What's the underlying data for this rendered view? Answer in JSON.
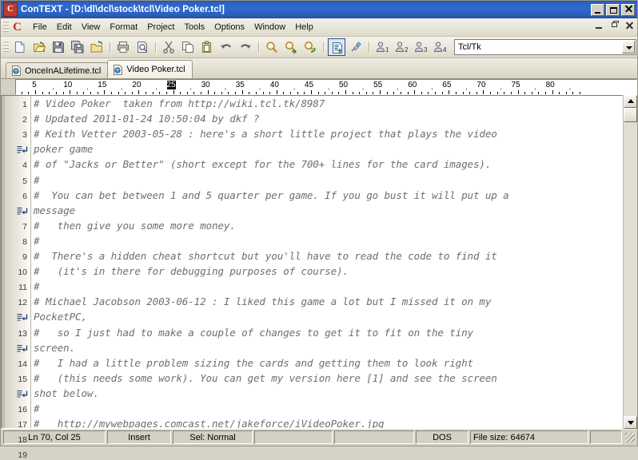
{
  "window": {
    "title": "ConTEXT - [D:\\dl\\dcl\\stock\\tcl\\Video Poker.tcl]",
    "app_icon": "C",
    "buttons": {
      "minimize": "minimize-icon",
      "maximize": "maximize-icon",
      "close": "close-icon"
    }
  },
  "menu": {
    "logo": "C",
    "items": [
      "File",
      "Edit",
      "View",
      "Format",
      "Project",
      "Tools",
      "Options",
      "Window",
      "Help"
    ],
    "mdi_buttons": [
      "mdi-minimize-icon",
      "mdi-restore-icon",
      "mdi-close-icon"
    ]
  },
  "toolbar": {
    "icons": [
      "new-file-icon",
      "open-file-icon",
      "save-icon",
      "save-all-icon",
      "open-project-icon",
      "print-icon",
      "print-preview-icon",
      "cut-icon",
      "copy-icon",
      "paste-icon",
      "undo-icon",
      "redo-icon",
      "find-icon",
      "find-next-icon",
      "replace-icon",
      "compile-icon",
      "bookmark-icon",
      "user-exec-1-icon",
      "user-exec-2-icon",
      "user-exec-3-icon",
      "user-exec-4-icon"
    ],
    "highlighter_label": "Tcl/Tk",
    "highlighter_options": [
      "Tcl/Tk"
    ]
  },
  "tabs": [
    {
      "label": "OnceInALifetime.tcl",
      "icon": "tcl-file-icon",
      "active": false
    },
    {
      "label": "Video Poker.tcl",
      "icon": "tcl-file-icon",
      "active": true
    }
  ],
  "ruler": {
    "numbers": [
      5,
      10,
      15,
      20,
      25,
      30,
      35,
      40,
      45,
      50,
      55,
      60,
      65,
      70,
      75,
      80
    ],
    "cursor_column": 25,
    "char_width": 8.62,
    "origin": 5
  },
  "editor": {
    "lines": [
      {
        "num": "1",
        "text": "# Video Poker  taken from http://wiki.tcl.tk/8987",
        "wrap": false
      },
      {
        "num": "2",
        "text": "# Updated 2011-01-24 10:50:04 by dkf ?",
        "wrap": false
      },
      {
        "num": "3",
        "text": "# Keith Vetter 2003-05-28 : here's a short little project that plays the video",
        "wrap": false
      },
      {
        "num": "",
        "text": "poker game",
        "wrap": true
      },
      {
        "num": "4",
        "text": "# of \"Jacks or Better\" (short except for the 700+ lines for the card images).",
        "wrap": false
      },
      {
        "num": "5",
        "text": "#",
        "wrap": false
      },
      {
        "num": "6",
        "text": "#  You can bet between 1 and 5 quarter per game. If you go bust it will put up a",
        "wrap": false
      },
      {
        "num": "",
        "text": "message",
        "wrap": true
      },
      {
        "num": "7",
        "text": "#   then give you some more money.",
        "wrap": false
      },
      {
        "num": "8",
        "text": "#",
        "wrap": false
      },
      {
        "num": "9",
        "text": "#  There's a hidden cheat shortcut but you'll have to read the code to find it",
        "wrap": false
      },
      {
        "num": "10",
        "text": "#   (it's in there for debugging purposes of course).",
        "wrap": false
      },
      {
        "num": "11",
        "text": "#",
        "wrap": false
      },
      {
        "num": "12",
        "text": "# Michael Jacobson 2003-06-12 : I liked this game a lot but I missed it on my",
        "wrap": false
      },
      {
        "num": "",
        "text": "PocketPC,",
        "wrap": true
      },
      {
        "num": "13",
        "text": "#   so I just had to make a couple of changes to get it to fit on the tiny",
        "wrap": false
      },
      {
        "num": "",
        "text": "screen.",
        "wrap": true
      },
      {
        "num": "14",
        "text": "#   I had a little problem sizing the cards and getting them to look right",
        "wrap": false
      },
      {
        "num": "15",
        "text": "#   (this needs some work). You can get my version here [1] and see the screen",
        "wrap": false
      },
      {
        "num": "",
        "text": "shot below.",
        "wrap": true
      },
      {
        "num": "16",
        "text": "#",
        "wrap": false
      },
      {
        "num": "17",
        "text": "#   http://mywebpages.comcast.net/jakeforce/iVideoPoker.jpg",
        "wrap": false
      },
      {
        "num": "18",
        "text": "#",
        "wrap": false
      },
      {
        "num": "19",
        "text": "",
        "wrap": false
      }
    ],
    "comment_color": "#6f6f6f"
  },
  "scrollbar": {
    "up": "scroll-up-icon",
    "down": "scroll-down-icon"
  },
  "statusbar": {
    "cursor": "Ln 70, Col 25",
    "insert_mode": "Insert",
    "selection": "Sel: Normal",
    "blank1": "",
    "blank2": "",
    "line_endings": "DOS",
    "file_size": "File size: 64674",
    "blank3": ""
  },
  "colors": {
    "title_bar": "#2f6ad0",
    "face": "#d4d0c4",
    "comment": "#6f6f6f",
    "accent": "#b43226"
  }
}
